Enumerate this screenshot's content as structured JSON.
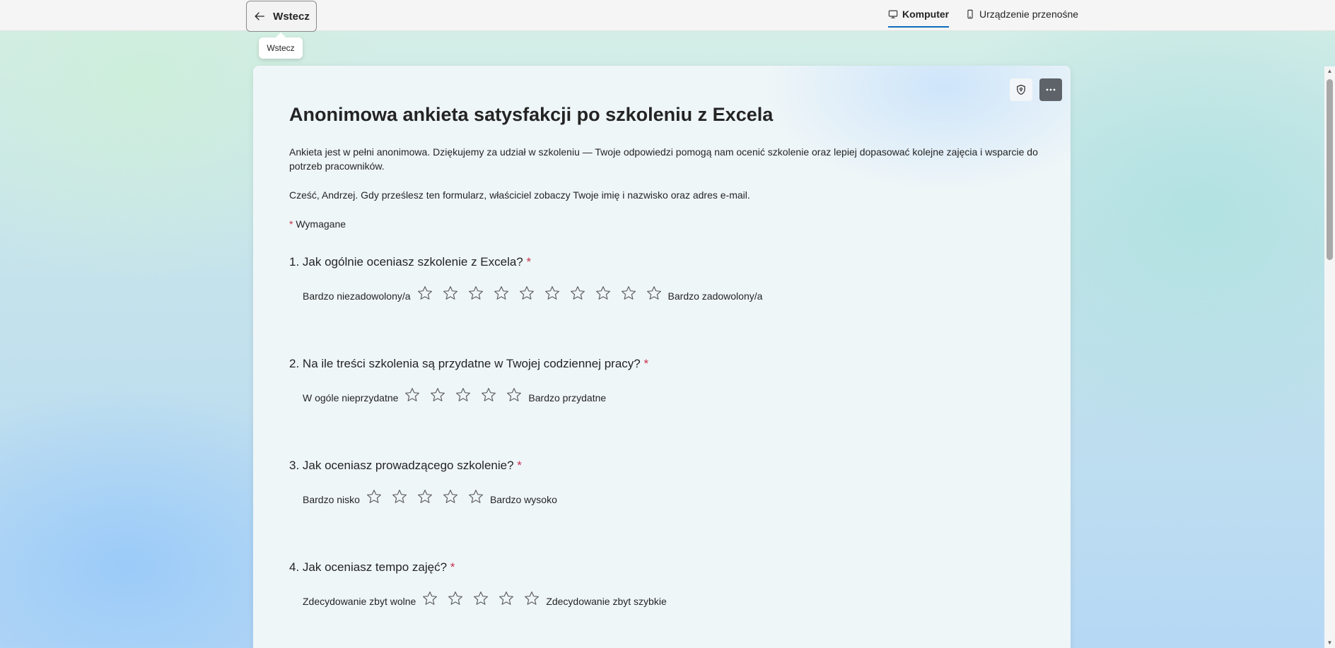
{
  "topbar": {
    "back_label": "Wstecz",
    "tooltip": "Wstecz",
    "tabs": [
      {
        "label": "Komputer",
        "icon": "monitor-icon",
        "active": true
      },
      {
        "label": "Urządzenie przenośne",
        "icon": "mobile-icon",
        "active": false
      }
    ]
  },
  "form": {
    "title": "Anonimowa ankieta satysfakcji po szkoleniu z Excela",
    "description": "Ankieta jest w pełni anonimowa. Dziękujemy za udział w szkoleniu — Twoje odpowiedzi pomogą nam ocenić szkolenie oraz lepiej dopasować kolejne zajęcia i wsparcie do potrzeb pracowników.",
    "greeting": "Cześć, Andrzej. Gdy prześlesz ten formularz, właściciel zobaczy Twoje imię i nazwisko oraz adres e-mail.",
    "required_asterisk": "*",
    "required_label": "Wymagane",
    "questions": [
      {
        "number": "1.",
        "text": "Jak ogólnie oceniasz szkolenie z Excela?",
        "required": "*",
        "min_label": "Bardzo niezadowolony/a",
        "max_label": "Bardzo zadowolony/a",
        "stars": 10
      },
      {
        "number": "2.",
        "text": "Na ile treści szkolenia są przydatne w Twojej codziennej pracy?",
        "required": "*",
        "min_label": "W ogóle nieprzydatne",
        "max_label": "Bardzo przydatne",
        "stars": 5
      },
      {
        "number": "3.",
        "text": "Jak oceniasz prowadzącego szkolenie?",
        "required": "*",
        "min_label": "Bardzo nisko",
        "max_label": "Bardzo wysoko",
        "stars": 5
      },
      {
        "number": "4.",
        "text": "Jak oceniasz tempo zajęć?",
        "required": "*",
        "min_label": "Zdecydowanie zbyt wolne",
        "max_label": "Zdecydowanie zbyt szybkie",
        "stars": 5
      }
    ]
  },
  "colors": {
    "accent": "#0f6cbd",
    "required": "#c4314b",
    "more_button": "#5d6368"
  }
}
